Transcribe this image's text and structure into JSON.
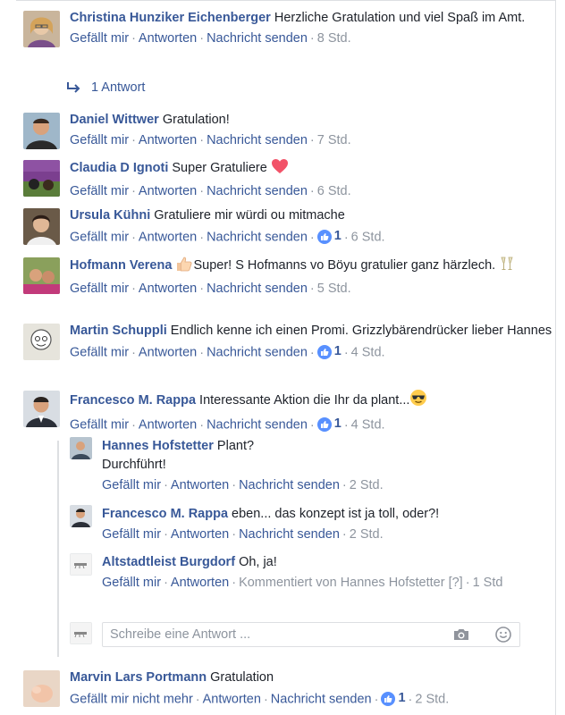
{
  "actions": {
    "like": "Gefällt mir",
    "like_undo": "Gefällt mir nicht mehr",
    "reply": "Antworten",
    "message": "Nachricht senden"
  },
  "comments": [
    {
      "name": "Christina Hunziker Eichenberger",
      "text": "Herzliche Gratulation und viel Spaß im Amt.",
      "time": "8 Std."
    },
    {
      "name": "Daniel Wittwer",
      "text": "Gratulation!",
      "time": "7 Std."
    },
    {
      "name": "Claudia D Ignoti",
      "text": "Super Gratuliere",
      "time": "6 Std.",
      "emoji": "heart"
    },
    {
      "name": "Ursula Kühni",
      "text": "Gratuliere mir würdi ou mitmache",
      "likes": "1",
      "time": "6 Std."
    },
    {
      "name": "Hofmann Verena",
      "text_a": "Super! S Hofmanns vo Böyu gratulier ganz härzlech.",
      "time": "5 Std."
    },
    {
      "name": "Martin Schuppli",
      "text": "Endlich kenne ich einen Promi. Grizzlybärendrücker lieber Hannes",
      "likes": "1",
      "time": "4 Std."
    },
    {
      "name": "Francesco M. Rappa",
      "text": "Interessante Aktion die Ihr da plant...",
      "likes": "1",
      "time": "4 Std."
    },
    {
      "name": "Marvin Lars Portmann",
      "text": "Gratulation",
      "likes": "1",
      "time": "2 Std."
    }
  ],
  "replies_toggle": "1 Antwort",
  "replies": [
    {
      "name": "Hannes Hofstetter",
      "line1": "Plant?",
      "line2": "Durchführt!",
      "time": "2 Std."
    },
    {
      "name": "Francesco M. Rappa",
      "text": "eben... das konzept ist ja toll, oder?!",
      "time": "2 Std."
    },
    {
      "name": "Altstadtleist Burgdorf",
      "text": "Oh, ja!",
      "commented_by": "Kommentiert von Hannes Hofstetter",
      "info": "[?]",
      "time": "1 Std"
    }
  ],
  "reply_input": {
    "placeholder": "Schreibe eine Antwort ..."
  },
  "colors": {
    "link": "#385898",
    "meta": "#8d949e",
    "like_blue": "#5890ff",
    "heart": "#f25268"
  }
}
